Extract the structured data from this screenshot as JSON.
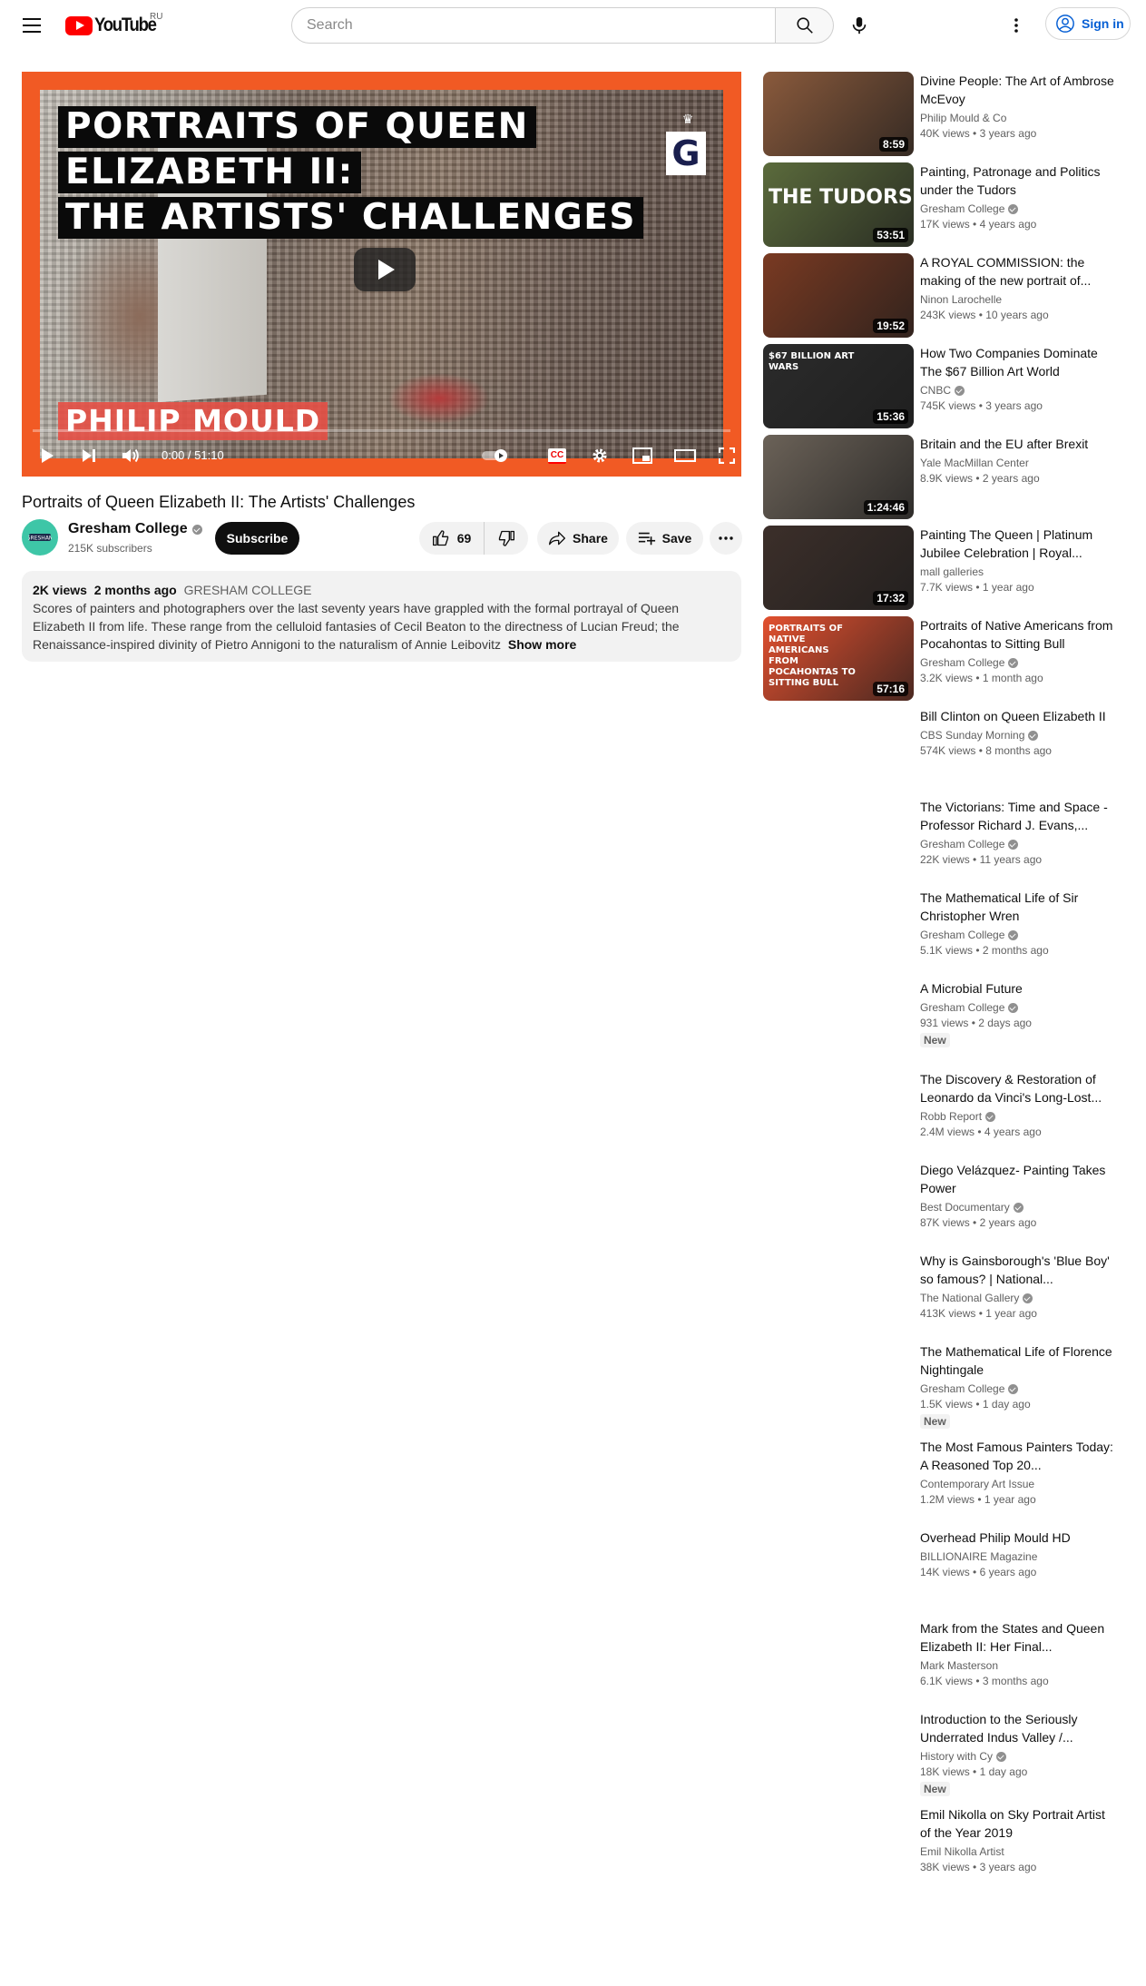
{
  "header": {
    "logo_text": "YouTube",
    "region": "RU",
    "search_placeholder": "Search",
    "sign_in_label": "Sign in"
  },
  "player": {
    "thumb_title_lines": [
      "PORTRAITS OF QUEEN",
      "ELIZABETH II:",
      "THE ARTISTS' CHALLENGES"
    ],
    "thumb_author": "PHILIP MOULD",
    "thumb_logo_letter": "G",
    "time": "0:00 / 51:10",
    "progress": 0,
    "cc_label": "CC"
  },
  "video": {
    "title": "Portraits of Queen Elizabeth II: The Artists' Challenges",
    "channel_name": "Gresham College",
    "subscribers": "215K subscribers",
    "subscribe_label": "Subscribe",
    "likes": "69",
    "share_label": "Share",
    "save_label": "Save"
  },
  "description": {
    "views": "2K views",
    "date": "2 months ago",
    "tag": "GRESHAM COLLEGE",
    "text": "Scores of painters and photographers over the last seventy years have grappled with the formal portrayal of Queen Elizabeth II from life. These range from the celluloid fantasies of Cecil Beaton to the directness of Lucian Freud; the Renaissance-inspired divinity of Pietro Annigoni to the naturalism of Annie Leibovitz",
    "show_more": "Show more"
  },
  "recommendations": [
    {
      "title": "Divine People: The Art of Ambrose McEvoy",
      "channel": "Philip Mould & Co",
      "verified": false,
      "views": "40K views",
      "age": "3 years ago",
      "duration": "8:59",
      "thumb_color": "#8a5a3c",
      "new": false
    },
    {
      "title": "Painting, Patronage and Politics under the Tudors",
      "channel": "Gresham College",
      "verified": true,
      "views": "17K views",
      "age": "4 years ago",
      "duration": "53:51",
      "thumb_color": "#5b6b3c",
      "thumb_caption": "THE TUDORS",
      "new": false
    },
    {
      "title": "A ROYAL COMMISSION: the making of the new portrait of...",
      "channel": "Ninon Larochelle",
      "verified": false,
      "views": "243K views",
      "age": "10 years ago",
      "duration": "19:52",
      "thumb_color": "#7a3a22",
      "new": false
    },
    {
      "title": "How Two Companies Dominate The $67 Billion Art World",
      "channel": "CNBC",
      "verified": true,
      "views": "745K views",
      "age": "3 years ago",
      "duration": "15:36",
      "thumb_color": "#2b2b2b",
      "thumb_caption": "$67 BILLION ART WARS",
      "new": false
    },
    {
      "title": "Britain and the EU after Brexit",
      "channel": "Yale MacMillan Center",
      "verified": false,
      "views": "8.9K views",
      "age": "2 years ago",
      "duration": "1:24:46",
      "thumb_color": "#6b6258",
      "new": false
    },
    {
      "title": "Painting The Queen | Platinum Jubilee Celebration | Royal...",
      "channel": "mall galleries",
      "verified": false,
      "views": "7.7K views",
      "age": "1 year ago",
      "duration": "17:32",
      "thumb_color": "#3c2f2a",
      "new": false
    },
    {
      "title": "Portraits of Native Americans from Pocahontas to Sitting Bull",
      "channel": "Gresham College",
      "verified": true,
      "views": "3.2K views",
      "age": "1 month ago",
      "duration": "57:16",
      "thumb_color": "#e2502f",
      "thumb_caption": "PORTRAITS OF NATIVE AMERICANS FROM POCAHONTAS TO SITTING BULL",
      "new": false
    },
    {
      "title": "Bill Clinton on Queen Elizabeth II",
      "channel": "CBS Sunday Morning",
      "verified": true,
      "views": "574K views",
      "age": "8 months ago",
      "new": false
    },
    {
      "title": "The Victorians: Time and Space - Professor Richard J. Evans,...",
      "channel": "Gresham College",
      "verified": true,
      "views": "22K views",
      "age": "11 years ago",
      "new": false
    },
    {
      "title": "The Mathematical Life of Sir Christopher Wren",
      "channel": "Gresham College",
      "verified": true,
      "views": "5.1K views",
      "age": "2 months ago",
      "new": false
    },
    {
      "title": "A Microbial Future",
      "channel": "Gresham College",
      "verified": true,
      "views": "931 views",
      "age": "2 days ago",
      "new": true
    },
    {
      "title": "The Discovery & Restoration of Leonardo da Vinci's Long-Lost...",
      "channel": "Robb Report",
      "verified": true,
      "views": "2.4M views",
      "age": "4 years ago",
      "new": false
    },
    {
      "title": "Diego Velázquez- Painting Takes Power",
      "channel": "Best Documentary",
      "verified": true,
      "views": "87K views",
      "age": "2 years ago",
      "new": false
    },
    {
      "title": "Why is Gainsborough's 'Blue Boy' so famous? | National...",
      "channel": "The National Gallery",
      "verified": true,
      "views": "413K views",
      "age": "1 year ago",
      "new": false
    },
    {
      "title": "The Mathematical Life of Florence Nightingale",
      "channel": "Gresham College",
      "verified": true,
      "views": "1.5K views",
      "age": "1 day ago",
      "new": true
    },
    {
      "title": "The Most Famous Painters Today: A Reasoned Top 20...",
      "channel": "Contemporary Art Issue",
      "verified": false,
      "views": "1.2M views",
      "age": "1 year ago",
      "new": false
    },
    {
      "title": "Overhead Philip Mould HD",
      "channel": "BILLIONAIRE Magazine",
      "verified": false,
      "views": "14K views",
      "age": "6 years ago",
      "new": false
    },
    {
      "title": "Mark from the States and Queen Elizabeth II: Her Final...",
      "channel": "Mark Masterson",
      "verified": false,
      "views": "6.1K views",
      "age": "3 months ago",
      "new": false
    },
    {
      "title": "Introduction to the Seriously Underrated Indus Valley /...",
      "channel": "History with Cy",
      "verified": true,
      "views": "18K views",
      "age": "1 day ago",
      "new": true
    },
    {
      "title": "Emil Nikolla on Sky Portrait Artist of the Year 2019",
      "channel": "Emil Nikolla Artist",
      "verified": false,
      "views": "38K views",
      "age": "3 years ago",
      "new": false
    }
  ],
  "new_label": "New",
  "colors": {
    "brand_red": "#ff0000",
    "player_frame": "#f15a24",
    "link_blue": "#065fd4",
    "avatar": "#3ec6a7"
  }
}
